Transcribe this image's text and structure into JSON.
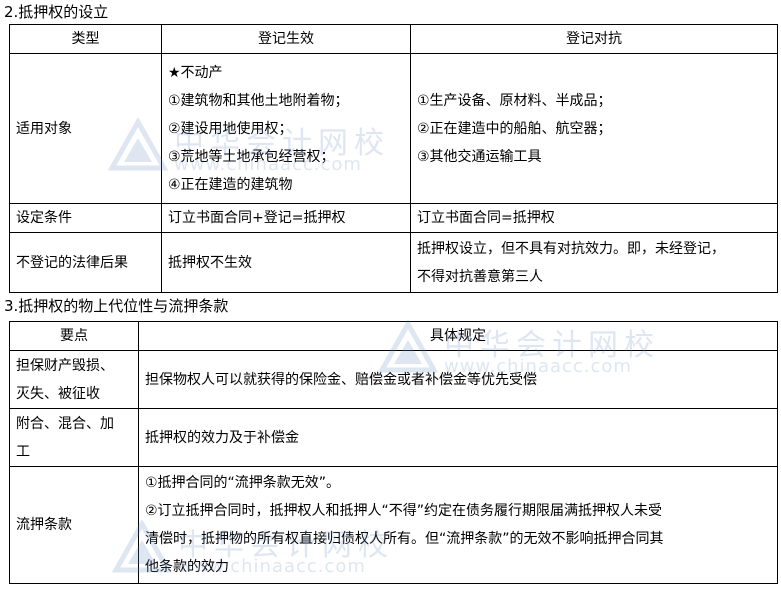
{
  "section1": {
    "heading": "2.抵押权的设立",
    "headers": [
      "类型",
      "登记生效",
      "登记对抗"
    ],
    "rows": [
      {
        "label": "适用对象",
        "effective": [
          "★不动产",
          "①建筑物和其他土地附着物；",
          "②建设用地使用权；",
          "③荒地等土地承包经营权；",
          "④正在建造的建筑物"
        ],
        "opposable": [
          "①生产设备、原材料、半成品；",
          "②正在建造中的船舶、航空器；",
          "③其他交通运输工具"
        ]
      },
      {
        "label": "设定条件",
        "effective": [
          "订立书面合同+登记=抵押权"
        ],
        "opposable": [
          "订立书面合同=抵押权"
        ]
      },
      {
        "label": "不登记的法律后果",
        "effective": [
          "抵押权不生效"
        ],
        "opposable": [
          "抵押权设立，但不具有对抗效力。即，未经登记，",
          "不得对抗善意第三人"
        ]
      }
    ]
  },
  "section2": {
    "heading": "3.抵押权的物上代位性与流押条款",
    "headers": [
      "要点",
      "具体规定"
    ],
    "rows": [
      {
        "label": [
          "担保财产毁损、",
          "灭失、被征收"
        ],
        "content": [
          "担保物权人可以就获得的保险金、赔偿金或者补偿金等优先受偿"
        ]
      },
      {
        "label": [
          "附合、混合、加",
          "工"
        ],
        "content": [
          "抵押权的效力及于补偿金"
        ]
      },
      {
        "label": [
          "流押条款"
        ],
        "content": [
          "①抵押合同的“流押条款无效”。",
          "②订立抵押合同时，抵押权人和抵押人“不得”约定在债务履行期限届满抵押权人未受",
          "清偿时，抵押物的所有权直接归债权人所有。但“流押条款”的无效不影响抵押合同其",
          "他条款的效力"
        ]
      }
    ]
  },
  "watermark": {
    "brand": "中华会计网校",
    "url": "www.chinaacc.com",
    "color": "#6b8fc6"
  }
}
